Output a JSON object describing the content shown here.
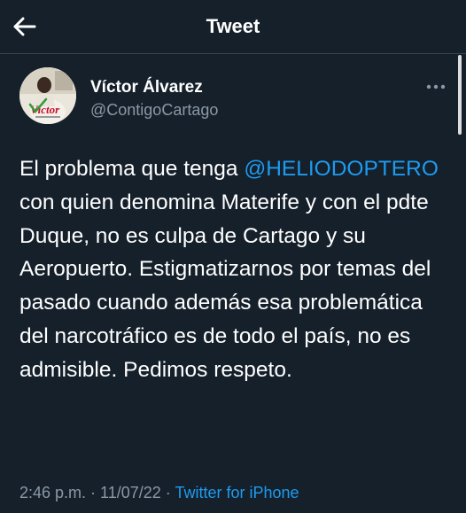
{
  "header": {
    "title": "Tweet",
    "back_icon": "arrow-left-icon"
  },
  "author": {
    "name": "Víctor Álvarez",
    "handle": "@ContigoCartago",
    "avatar_logo_text": "Víctor"
  },
  "more_icon": "ellipsis-icon",
  "tweet": {
    "text_before_mention": "El problema que tenga ",
    "mention": "@HELIODOPTERO",
    "text_after_mention": " con quien denomina Materife y con el pdte Duque, no es culpa de Cartago y su Aeropuerto. Estigmatizarnos por temas del pasado cuando además esa problemática del narcotráfico es de todo el país, no es admisible. Pedimos respeto."
  },
  "meta": {
    "time": "2:46 p.m.",
    "separator": " · ",
    "date": "11/07/22",
    "separator2": " · ",
    "source": "Twitter for iPhone"
  },
  "colors": {
    "background": "#15202b",
    "text": "#ffffff",
    "secondary_text": "#8b98a5",
    "accent": "#1d9bf0",
    "divider": "#38444d"
  }
}
